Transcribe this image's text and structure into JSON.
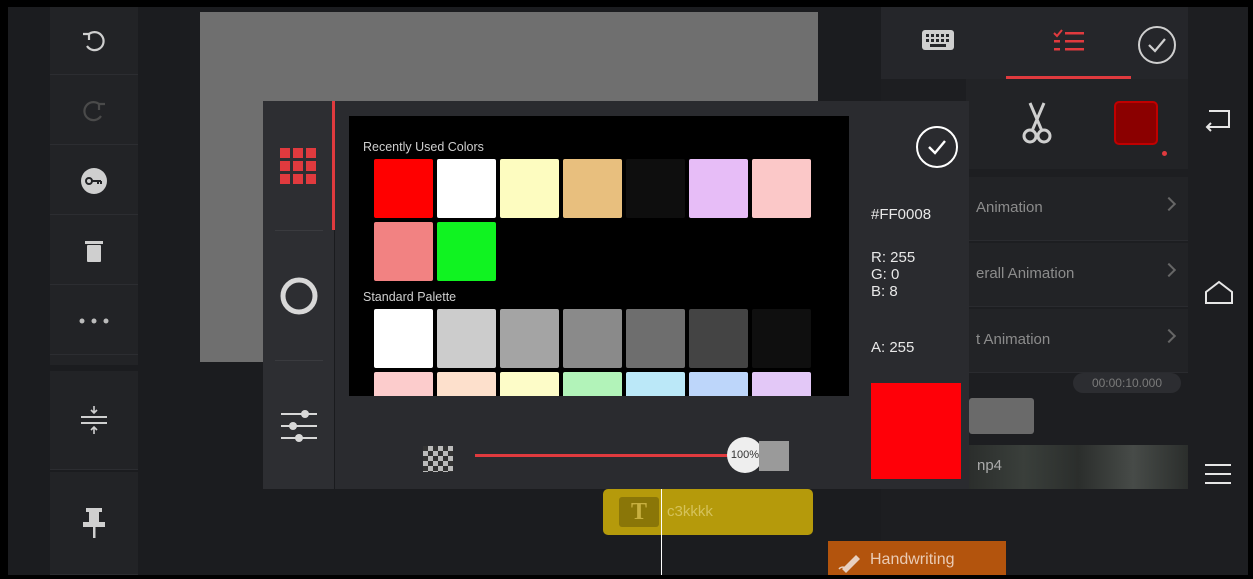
{
  "left_toolbar": [
    {
      "icon": "undo-icon"
    },
    {
      "icon": "redo-icon"
    },
    {
      "icon": "keyframe-icon"
    },
    {
      "icon": "trash-icon"
    },
    {
      "icon": "more-icon"
    },
    {
      "icon": "split-layout-icon"
    },
    {
      "icon": "pin-icon"
    }
  ],
  "right_panel": {
    "tabs": [
      {
        "icon": "keyboard-icon"
      },
      {
        "icon": "checklist-icon"
      },
      {
        "icon": "confirm-icon"
      }
    ],
    "rows": [
      {
        "label": "Animation"
      },
      {
        "label": "erall Animation"
      },
      {
        "label": "t Animation"
      }
    ],
    "timecode": "00:00:10.000",
    "clip_label": "np4"
  },
  "timeline": {
    "text_clip_label": "c3kkkk",
    "handwriting_label": "Handwriting"
  },
  "color_picker": {
    "recent_label": "Recently Used Colors",
    "standard_label": "Standard Palette",
    "recent_colors": [
      "#ff0000",
      "#ffffff",
      "#fdfcc0",
      "#e8bf7e",
      "#0e0e0e",
      "#e7bdf7",
      "#fbc8c8",
      "#f28282",
      "#10f321"
    ],
    "standard_colors_row1": [
      "#ffffff",
      "#cccccc",
      "#a4a4a4",
      "#8a8a8a",
      "#6e6e6e",
      "#444444",
      "#0f0f0f"
    ],
    "standard_colors_row2": [
      "#fccccc",
      "#fde0cc",
      "#fdfcc8",
      "#b2f3b9",
      "#bbe8f8",
      "#bdd6fa",
      "#e3c8f7"
    ],
    "hex": "#FF0008",
    "r": "R: 255",
    "g": "G: 0",
    "b": "B: 8",
    "a": "A: 255",
    "opacity": "100%",
    "opacity_value": 1.0,
    "selected_color": "#ff0008",
    "accent": "#e03a3e"
  }
}
